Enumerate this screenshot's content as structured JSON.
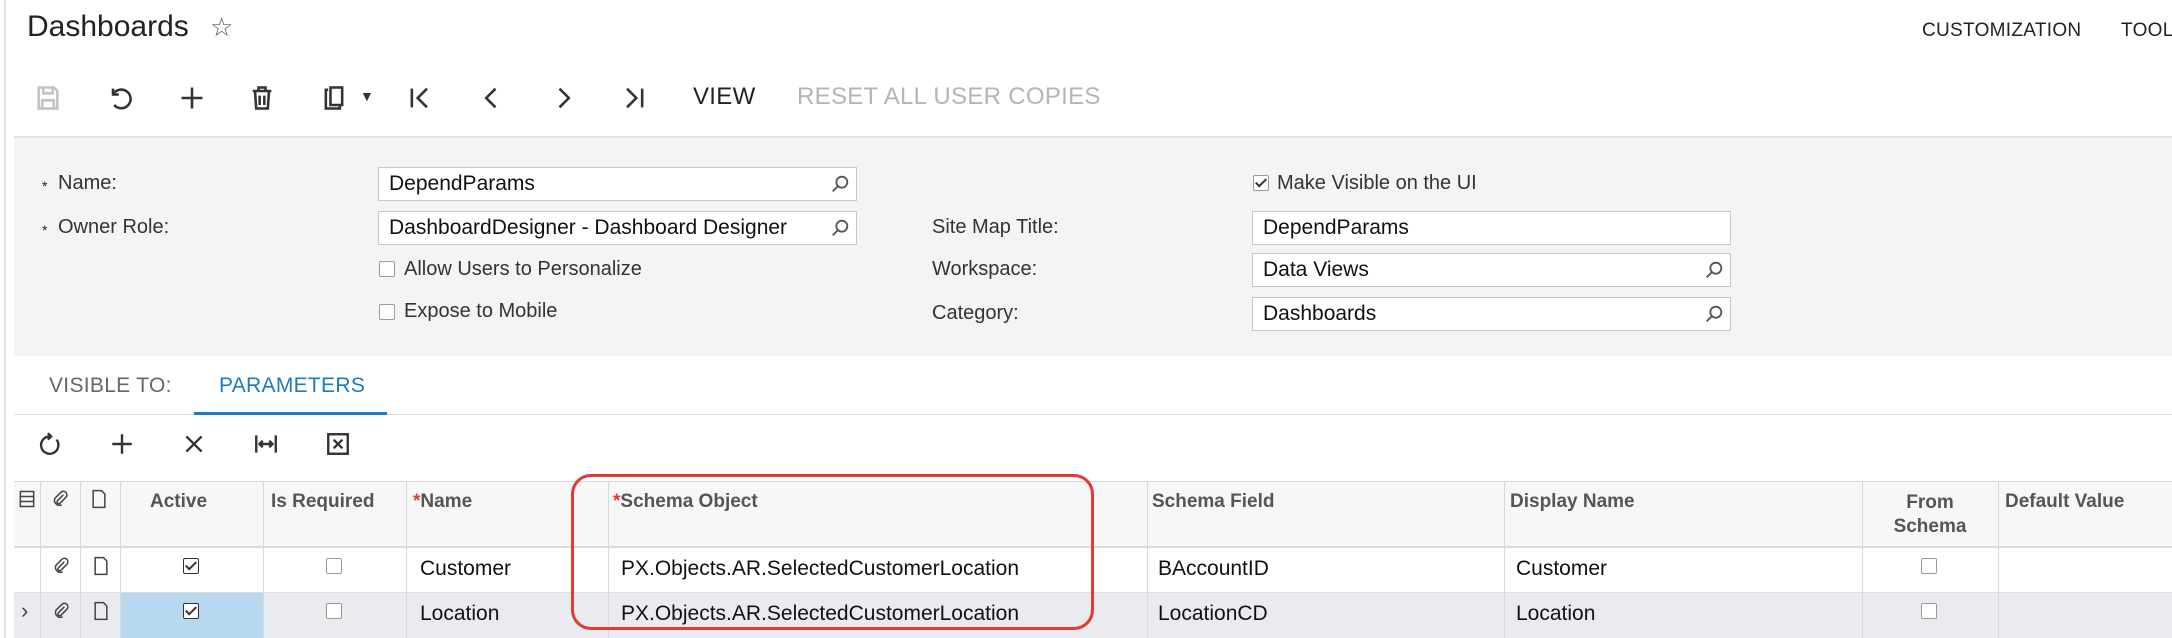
{
  "header": {
    "title": "Dashboards",
    "menu": [
      "CUSTOMIZATION",
      "TOOL"
    ]
  },
  "toolbar": {
    "view_label": "VIEW",
    "reset_label": "RESET ALL USER COPIES"
  },
  "form": {
    "name_label": "Name:",
    "name_value": "DependParams",
    "owner_label": "Owner Role:",
    "owner_value": "DashboardDesigner - Dashboard Designer",
    "allow_personalize_label": "Allow Users to Personalize",
    "expose_mobile_label": "Expose to Mobile",
    "make_visible_label": "Make Visible on the UI",
    "sitemap_label": "Site Map Title:",
    "sitemap_value": "DependParams",
    "workspace_label": "Workspace:",
    "workspace_value": "Data Views",
    "category_label": "Category:",
    "category_value": "Dashboards"
  },
  "tabs": [
    {
      "label": "VISIBLE TO:"
    },
    {
      "label": "PARAMETERS"
    }
  ],
  "grid": {
    "headers": {
      "active": "Active",
      "is_required": "Is Required",
      "name": "Name",
      "schema_object": "Schema Object",
      "schema_field": "Schema Field",
      "display_name": "Display Name",
      "from_schema_1": "From",
      "from_schema_2": "Schema",
      "default_value": "Default Value"
    },
    "rows": [
      {
        "name": "Customer",
        "schema_object": "PX.Objects.AR.SelectedCustomerLocation",
        "schema_field": "BAccountID",
        "display_name": "Customer"
      },
      {
        "name": "Location",
        "schema_object": "PX.Objects.AR.SelectedCustomerLocation",
        "schema_field": "LocationCD",
        "display_name": "Location"
      }
    ]
  },
  "colors": {
    "accent": "#1a7ac4",
    "highlight": "#e43a34",
    "selected_cell": "#b7d8ef"
  }
}
